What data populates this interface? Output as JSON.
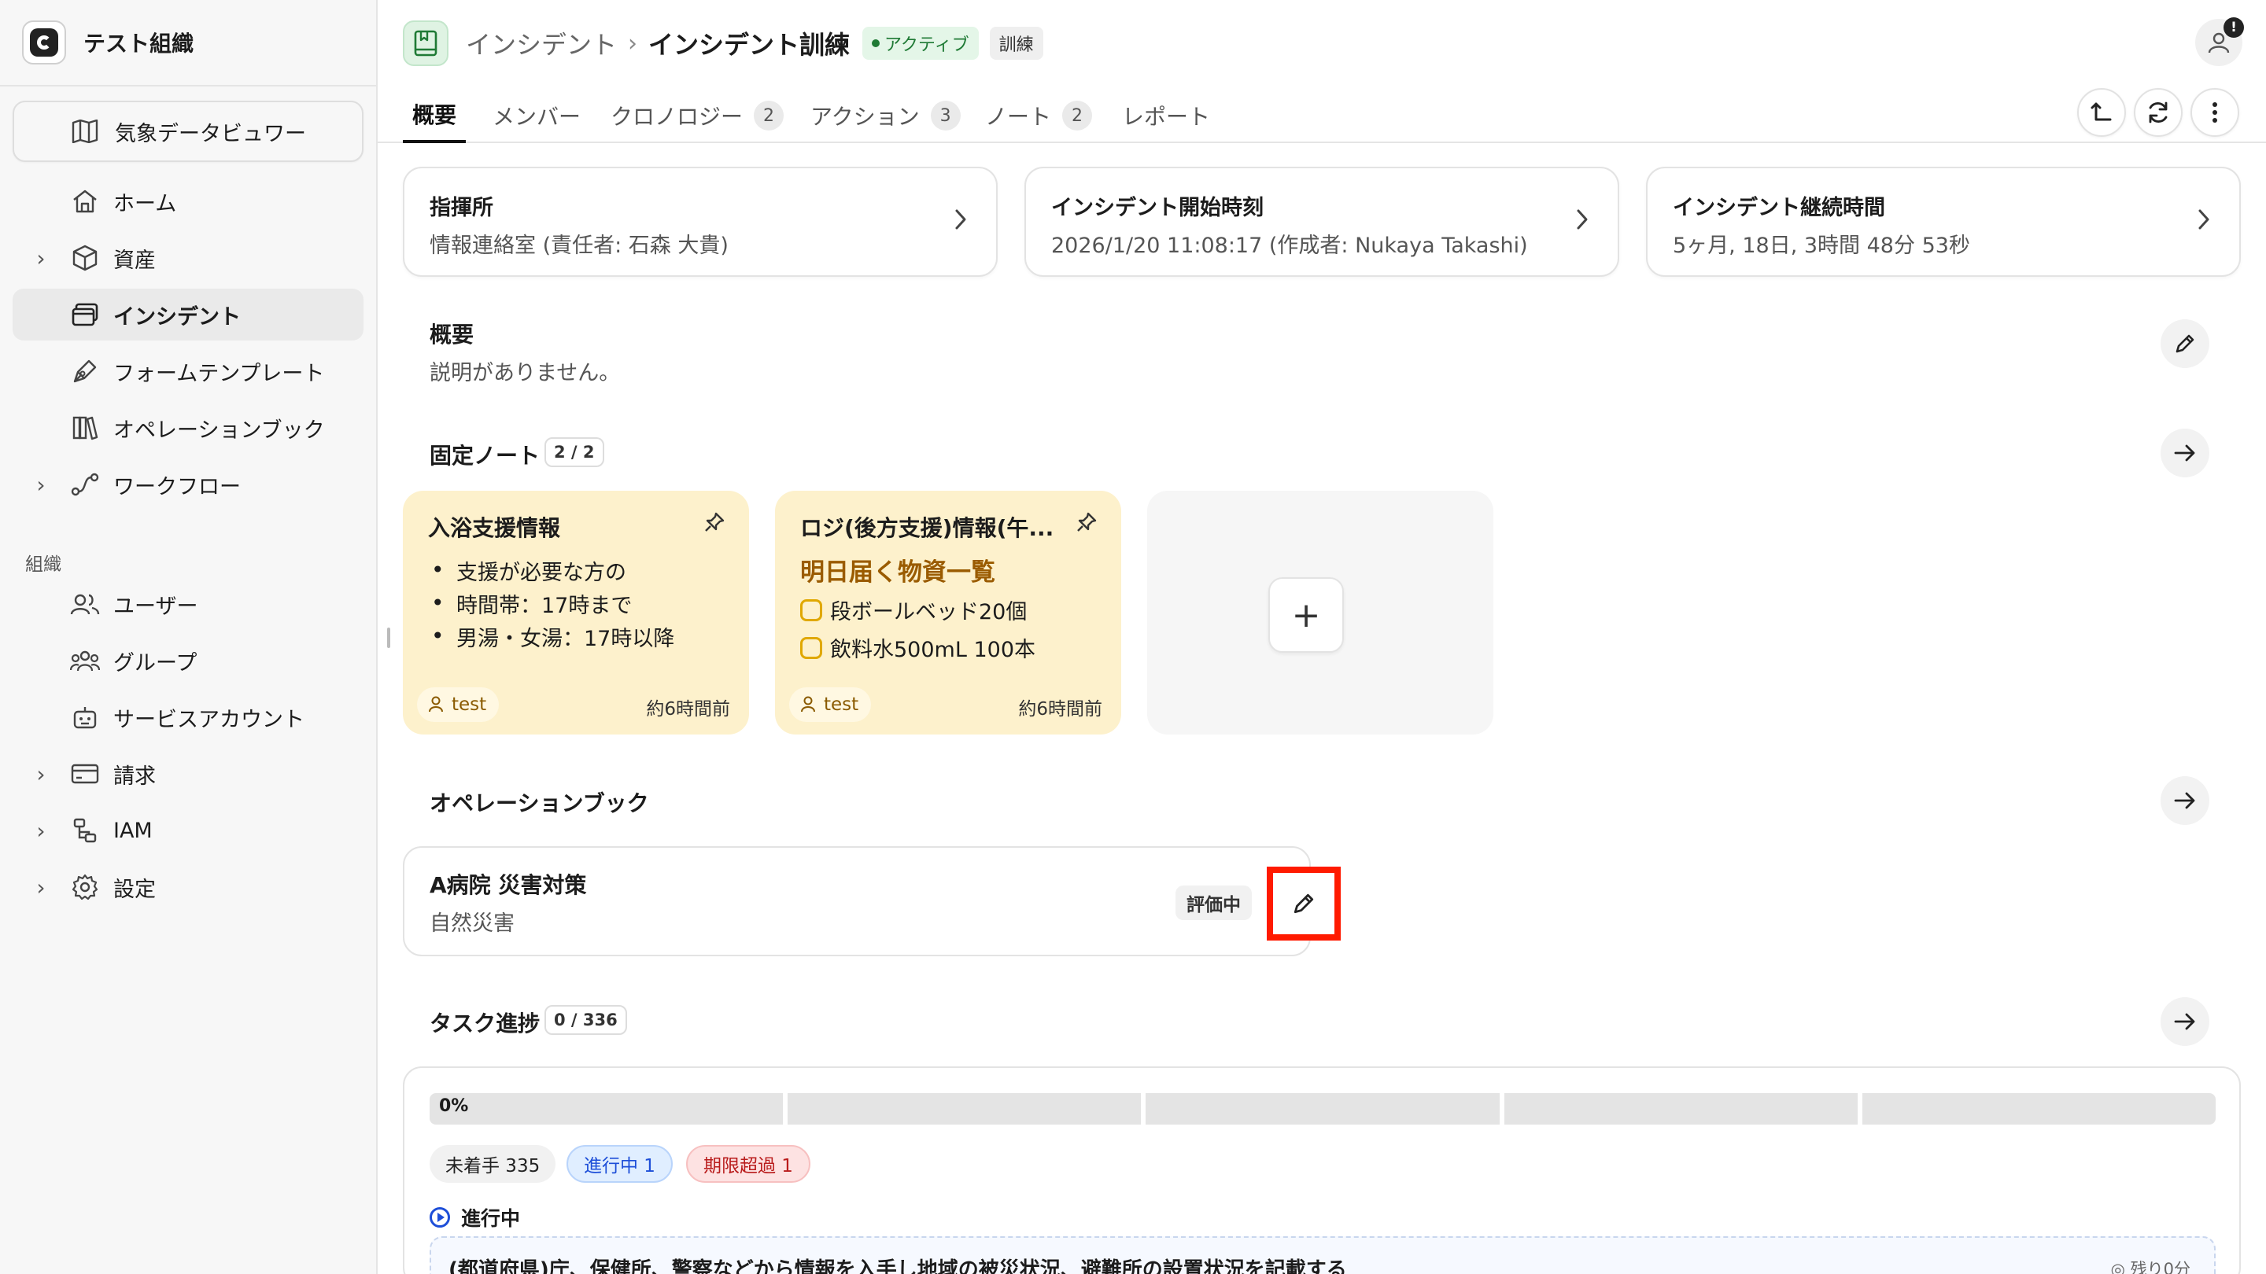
{
  "org": {
    "name": "テスト組織"
  },
  "sidebar": {
    "weather_viewer": "気象データビュワー",
    "items": [
      {
        "label": "ホーム"
      },
      {
        "label": "資産"
      },
      {
        "label": "インシデント"
      },
      {
        "label": "フォームテンプレート"
      },
      {
        "label": "オペレーションブック"
      },
      {
        "label": "ワークフロー"
      }
    ],
    "section_label": "組織",
    "org_items": [
      {
        "label": "ユーザー"
      },
      {
        "label": "グループ"
      },
      {
        "label": "サービスアカウント"
      },
      {
        "label": "請求"
      },
      {
        "label": "IAM"
      },
      {
        "label": "設定"
      }
    ]
  },
  "header": {
    "breadcrumb_root": "インシデント",
    "breadcrumb_sep": "›",
    "title": "インシデント訓練",
    "badge_active": "アクティブ",
    "badge_training": "訓練",
    "notification": "!"
  },
  "tabs": [
    {
      "label": "概要"
    },
    {
      "label": "メンバー"
    },
    {
      "label": "クロノロジー",
      "count": "2"
    },
    {
      "label": "アクション",
      "count": "3"
    },
    {
      "label": "ノート",
      "count": "2"
    },
    {
      "label": "レポート"
    }
  ],
  "info_cards": [
    {
      "title": "指揮所",
      "value": "情報連絡室 (責任者: 石森 大貴)"
    },
    {
      "title": "インシデント開始時刻",
      "value": "2026/1/20 11:08:17 (作成者: Nukaya Takashi)"
    },
    {
      "title": "インシデント継続時間",
      "value": "5ヶ月, 18日, 3時間 48分 53秒"
    }
  ],
  "summary": {
    "title": "概要",
    "text": "説明がありません。"
  },
  "pinned": {
    "title": "固定ノート",
    "count": "2 / 2",
    "notes": [
      {
        "title": "入浴支援情報",
        "bullets": [
          "支援が必要な方の",
          "時間帯：17時まで",
          "男湯・女湯：17時以降"
        ],
        "user": "test",
        "time": "約6時間前"
      },
      {
        "title": "ロジ(後方支援)情報(午...",
        "heading": "明日届く物資一覧",
        "checks": [
          "段ボールベッド20個",
          "飲料水500mL 100本"
        ],
        "user": "test",
        "time": "約6時間前"
      }
    ],
    "add_label": "+"
  },
  "opbook": {
    "title": "オペレーションブック",
    "item_title": "A病院 災害対策",
    "item_sub": "自然災害",
    "status": "評価中"
  },
  "tasks": {
    "title": "タスク進捗",
    "count": "0 / 336",
    "percent": "0%",
    "badges": [
      "未着手 335",
      "進行中 1",
      "期限超過 1"
    ],
    "in_progress_label": "進行中",
    "row_text": "(都道府県)庁、保健所、警察などから情報を入手し地域の被災状況、避難所の設置状況を記載する",
    "row_meta": "◎ 残り0分"
  },
  "colors": {
    "accent_green": "#1f7a35",
    "highlight": "#ff1a00",
    "note_bg": "#fdf1cc"
  }
}
